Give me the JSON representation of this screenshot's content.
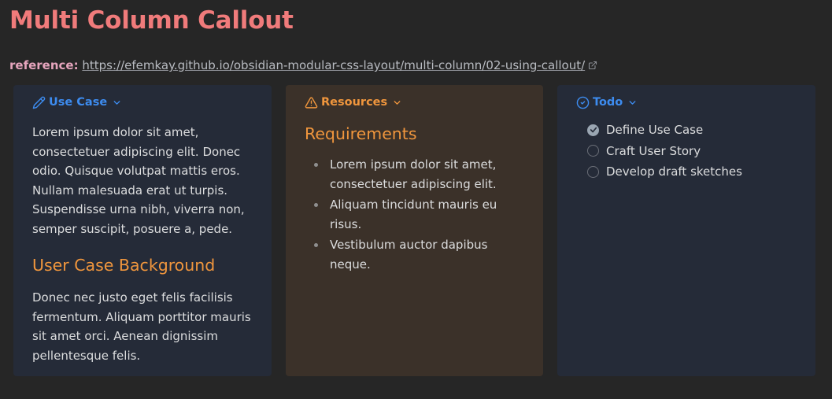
{
  "page": {
    "title": "Multi Column Callout"
  },
  "reference": {
    "label": "reference:",
    "url_text": "https://efemkay.github.io/obsidian-modular-css-layout/multi-column/02-using-callout/",
    "icon": "external-link-icon"
  },
  "colors": {
    "title": "#f07b7b",
    "blue_accent": "#3d8cf0",
    "orange_accent": "#f0963d",
    "callout_blue_bg": "#252b38",
    "callout_orange_bg": "#3b3129",
    "page_bg": "#262626"
  },
  "callouts": {
    "use_case": {
      "title": "Use Case",
      "icon": "pencil-icon",
      "paragraph1": "Lorem ipsum dolor sit amet, consectetuer adipiscing elit. Donec odio. Quisque volutpat mattis eros. Nullam malesuada erat ut turpis. Suspendisse urna nibh, viverra non, semper suscipit, posuere a, pede.",
      "heading": "User Case Background",
      "paragraph2": "Donec nec justo eget felis facilisis fermentum. Aliquam porttitor mauris sit amet orci. Aenean dignissim pellentesque felis."
    },
    "resources": {
      "title": "Resources",
      "icon": "warning-icon",
      "heading": "Requirements",
      "items": [
        "Lorem ipsum dolor sit amet, consectetuer adipiscing elit.",
        "Aliquam tincidunt mauris eu risus.",
        "Vestibulum auctor dapibus neque."
      ]
    },
    "todo": {
      "title": "Todo",
      "icon": "check-circle-icon",
      "items": [
        {
          "label": "Define Use Case",
          "checked": true
        },
        {
          "label": "Craft User Story",
          "checked": false
        },
        {
          "label": "Develop draft sketches",
          "checked": false
        }
      ]
    }
  }
}
